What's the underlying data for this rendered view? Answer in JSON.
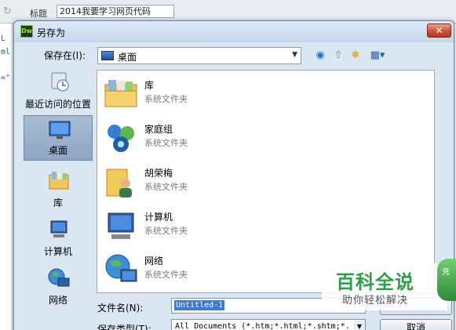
{
  "background_app": {
    "title_label": "标题",
    "title_value": "2014我要学习网页代码",
    "code_lines": [
      "L",
      "ml",
      "=\""
    ]
  },
  "dialog": {
    "title": "另存为",
    "app_badge": "Dw",
    "close_label": "✕",
    "save_in_label": "保存在(I):",
    "save_in_value": "桌面",
    "places": [
      {
        "label": "最近访问的位置",
        "icon": "recent-places-icon"
      },
      {
        "label": "桌面",
        "icon": "desktop-icon",
        "selected": true
      },
      {
        "label": "库",
        "icon": "libraries-icon"
      },
      {
        "label": "计算机",
        "icon": "computer-icon"
      },
      {
        "label": "网络",
        "icon": "network-icon"
      }
    ],
    "items": [
      {
        "name": "库",
        "desc": "系统文件夹",
        "icon": "libraries-folder-icon"
      },
      {
        "name": "家庭组",
        "desc": "系统文件夹",
        "icon": "homegroup-icon"
      },
      {
        "name": "胡荣梅",
        "desc": "系统文件夹",
        "icon": "user-folder-icon"
      },
      {
        "name": "计算机",
        "desc": "系统文件夹",
        "icon": "computer-icon"
      },
      {
        "name": "网络",
        "desc": "系统文件夹",
        "icon": "network-icon"
      }
    ],
    "filename_label": "文件名(N):",
    "filename_value": "Untitled-1",
    "filetype_label": "保存类型(T):",
    "filetype_value": "All Documents (*.htm;*.html;*.shtm;*.",
    "cancel_label": "取消"
  },
  "watermark": {
    "title": "百科全说",
    "subtitle": "助你轻松解决",
    "side_text": "充"
  }
}
